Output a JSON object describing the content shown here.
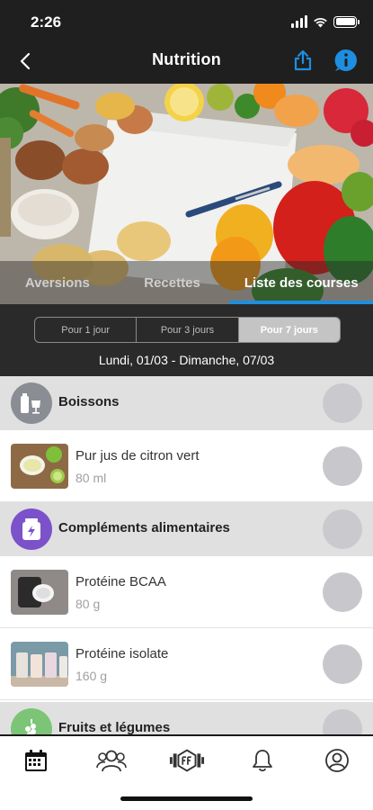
{
  "status_bar": {
    "time": "2:26"
  },
  "nav": {
    "title": "Nutrition"
  },
  "tabs": [
    {
      "label": "Aversions",
      "active": false
    },
    {
      "label": "Recettes",
      "active": false
    },
    {
      "label": "Liste des courses",
      "active": true
    }
  ],
  "period": {
    "options": [
      {
        "label": "Pour 1 jour",
        "active": false
      },
      {
        "label": "Pour 3 jours",
        "active": false
      },
      {
        "label": "Pour 7 jours",
        "active": true
      }
    ],
    "date_range": "Lundi, 01/03 - Dimanche, 07/03"
  },
  "list": {
    "cat_boissons": "Boissons",
    "item_citron": {
      "name": "Pur jus de citron vert",
      "qty": "80 ml"
    },
    "cat_complements": "Compléments alimentaires",
    "item_bcaa": {
      "name": "Protéine BCAA",
      "qty": "80 g"
    },
    "item_isolate": {
      "name": "Protéine isolate",
      "qty": "160 g"
    },
    "cat_fruits": "Fruits et légumes"
  },
  "icons": {
    "back": "chevron-left-icon",
    "share": "share-icon",
    "info": "info-icon",
    "boissons": "drinks-icon",
    "complements": "supplement-jar-icon",
    "fruits": "produce-icon",
    "tabbar": [
      "calendar-icon",
      "community-icon",
      "fitness-logo-icon",
      "bell-icon",
      "profile-icon"
    ]
  },
  "colors": {
    "accent": "#1e8ee0",
    "header_bg": "#1f1f1f",
    "category_bg": "#e0e0e0",
    "boissons_icon_bg": "#8a8d93",
    "complements_icon_bg": "#7b52c9",
    "fruits_icon_bg": "#7cc576"
  }
}
